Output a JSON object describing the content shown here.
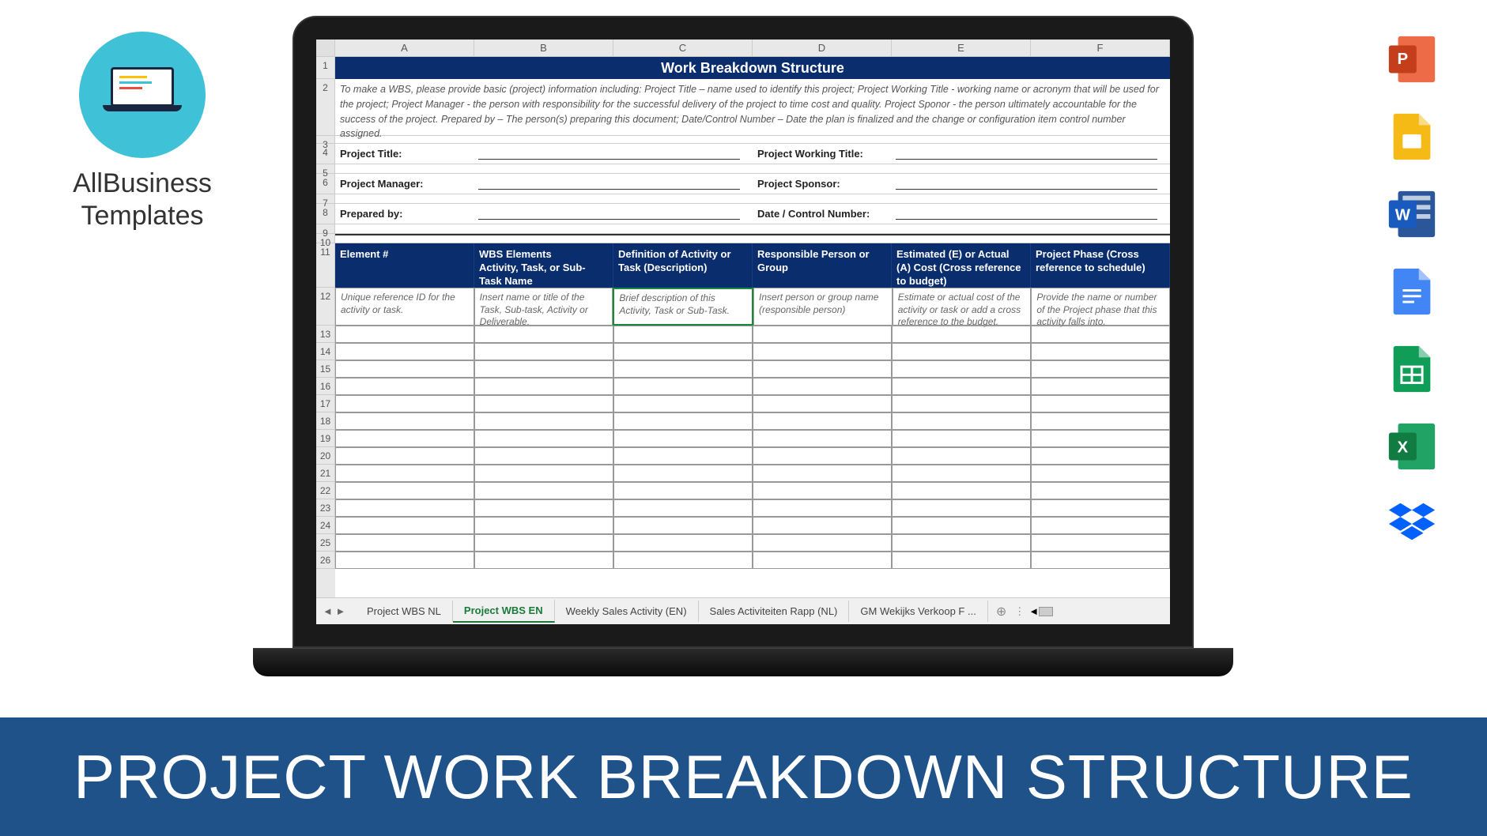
{
  "logo": {
    "line1": "AllBusiness",
    "line2": "Templates"
  },
  "banner": "PROJECT WORK BREAKDOWN STRUCTURE",
  "spreadsheet": {
    "columns": [
      "A",
      "B",
      "C",
      "D",
      "E",
      "F"
    ],
    "title": "Work Breakdown Structure",
    "instructions": "To make a WBS, please provide basic (project) information including: Project Title – name used to identify this project; Project Working Title - working name or acronym that will be used for the project; Project Manager - the person with responsibility for the successful delivery of the project to time cost and quality. Project Sponor - the person ultimately accountable for the success of the project. Prepared by – The person(s) preparing this document; Date/Control Number – Date the plan is finalized and the change or configuration item control number assigned.",
    "info_rows": [
      {
        "left": "Project Title:",
        "right": "Project Working Title:"
      },
      {
        "left": "Project Manager:",
        "right": "Project Sponsor:"
      },
      {
        "left": "Prepared by:",
        "right": "Date / Control Number:"
      }
    ],
    "headers": [
      "Element #",
      "WBS Elements\nActivity, Task, or Sub-Task Name",
      "Definition of Activity or Task (Description)",
      "Responsible Person or Group",
      "Estimated (E) or Actual (A) Cost (Cross reference to budget)",
      "Project Phase (Cross reference to schedule)"
    ],
    "hints": [
      "Unique reference ID for the activity or task.",
      "Insert name or title of the Task, Sub-task, Activity or Deliverable.",
      "Brief description of this Activity, Task or Sub-Task.",
      "Insert person or group name (responsible person)",
      "Estimate or actual cost of the activity or task or add a cross reference to the budget.",
      "Provide the name or number of the Project phase that this activity falls into."
    ],
    "row_numbers": [
      1,
      2,
      3,
      4,
      5,
      6,
      7,
      8,
      9,
      10,
      11,
      12,
      13,
      14,
      15,
      16,
      17,
      18,
      19,
      20,
      21,
      22,
      23,
      24,
      25,
      26
    ],
    "tabs": [
      "Project WBS NL",
      "Project WBS EN",
      "Weekly Sales Activity (EN)",
      "Sales Activiteiten Rapp (NL)",
      "GM Wekijks Verkoop F ..."
    ],
    "active_tab": 1
  },
  "file_types": [
    "powerpoint",
    "google-slides",
    "word",
    "google-docs",
    "google-sheets",
    "excel",
    "dropbox"
  ]
}
